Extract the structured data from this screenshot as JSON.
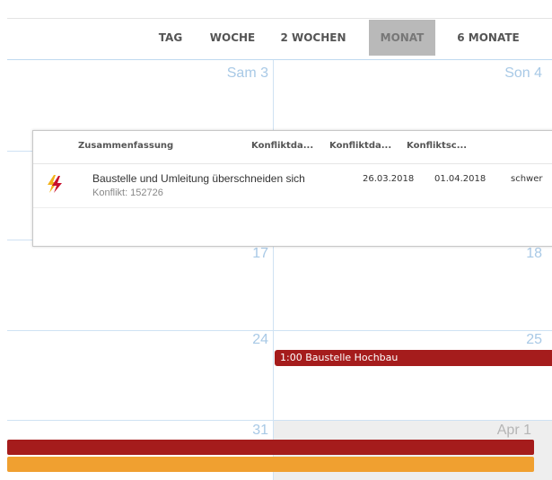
{
  "views": [
    "TAG",
    "WOCHE",
    "2 WOCHEN",
    "MONAT",
    "6 MONATE"
  ],
  "active_view": "MONAT",
  "calendar": {
    "day_labels": [
      "Sam 3",
      "Son 4",
      "17",
      "18",
      "24",
      "25",
      "31",
      "Apr 1"
    ]
  },
  "events": {
    "hochbau": "1:00 Baustelle Hochbau"
  },
  "popup": {
    "columns": [
      "Zusammenfassung",
      "Konfliktda...",
      "Konfliktda...",
      "Konfliktsc..."
    ],
    "rows": [
      {
        "title": "Baustelle und Umleitung überschneiden sich",
        "subtitle": "Konflikt: 152726",
        "start": "26.03.2018",
        "end": "01.04.2018",
        "severity": "schwer",
        "icon": "lightning-conflict-icon"
      }
    ]
  },
  "colors": {
    "accent_red": "#a51c1c",
    "accent_orange": "#f0a030",
    "grid": "#cfe2f3",
    "day_number": "#a8c9e6"
  }
}
